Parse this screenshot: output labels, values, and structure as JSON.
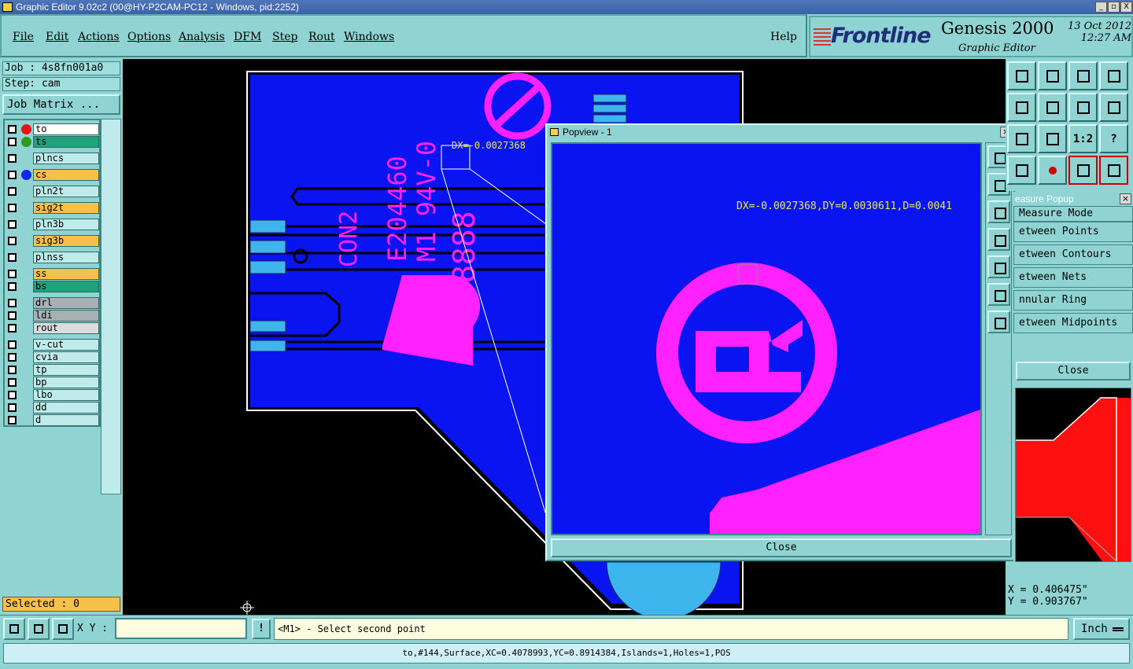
{
  "window": {
    "title": "Graphic Editor 9.02c2 (00@HY-P2CAM-PC12 - Windows, pid:2252)",
    "controls": [
      "_",
      "▫",
      "X"
    ]
  },
  "menu": {
    "items": [
      "File",
      "Edit",
      "Actions",
      "Options",
      "Analysis",
      "DFM",
      "Step",
      "Rout",
      "Windows"
    ],
    "help": "Help"
  },
  "brand": {
    "logo": "Frontline",
    "product": "Genesis 2000",
    "subtitle": "Graphic Editor",
    "date": "13 Oct 2012",
    "time": "12:27 AM"
  },
  "job": {
    "job_label": "Job : 4s8fn001a0",
    "step_label": "Step: cam",
    "matrix_button": "Job Matrix ..."
  },
  "layers": [
    {
      "name": "to",
      "color": "#ffffff",
      "dot": "#ee1010"
    },
    {
      "name": "ts",
      "color": "#1fa37a",
      "dot": "#2a9d20"
    },
    {
      "name": "plncs",
      "color": "#bfeceb",
      "dot": ""
    },
    {
      "name": "cs",
      "color": "#f6c04a",
      "dot": "#1028ee"
    },
    {
      "name": "pln2t",
      "color": "#bfeceb",
      "dot": ""
    },
    {
      "name": "sig2t",
      "color": "#f6c04a",
      "dot": ""
    },
    {
      "name": "pln3b",
      "color": "#bfeceb",
      "dot": ""
    },
    {
      "name": "sig3b",
      "color": "#f6c04a",
      "dot": ""
    },
    {
      "name": "plnss",
      "color": "#bfeceb",
      "dot": ""
    },
    {
      "name": "ss",
      "color": "#f6c04a",
      "dot": ""
    },
    {
      "name": "bs",
      "color": "#1fa37a",
      "dot": ""
    },
    {
      "name": "drl",
      "color": "#a8b0b4",
      "dot": ""
    },
    {
      "name": "ldi",
      "color": "#a8b0b4",
      "dot": ""
    },
    {
      "name": "rout",
      "color": "#dcdcdc",
      "dot": ""
    },
    {
      "name": "v-cut",
      "color": "#bfeceb",
      "dot": ""
    },
    {
      "name": "cvia",
      "color": "#bfeceb",
      "dot": ""
    },
    {
      "name": "tp",
      "color": "#bfeceb",
      "dot": ""
    },
    {
      "name": "bp",
      "color": "#bfeceb",
      "dot": ""
    },
    {
      "name": "lbo",
      "color": "#bfeceb",
      "dot": ""
    },
    {
      "name": "dd",
      "color": "#bfeceb",
      "dot": ""
    },
    {
      "name": "d",
      "color": "#bfeceb",
      "dot": ""
    }
  ],
  "selected": "Selected : 0",
  "board": {
    "silk_texts": [
      "CON2",
      "E204460",
      "M1 94V-0",
      "8888"
    ],
    "measure_label_main": "DX=-0.0027368",
    "copper_color": "#0a14f0",
    "silk_color": "#ff22ff",
    "pad_color": "#3fb5ee"
  },
  "popview": {
    "title": "Popview - 1",
    "measure_text": "DX=-0.0027368,DY=0.0030611,D=0.0041",
    "close": "Close"
  },
  "tools": {
    "ratio_label": "1:2",
    "help_label": "?"
  },
  "measure": {
    "title": "easure Popup",
    "mode_label": "Measure Mode",
    "modes": [
      "etween Points",
      "etween Contours",
      "etween Nets",
      "nnular Ring",
      "etween Midpoints"
    ],
    "close": "Close"
  },
  "coords": {
    "x": "X = 0.406475\"",
    "y": "Y = 0.903767\""
  },
  "command": {
    "xy_label": "X Y :",
    "xy_value": "",
    "bang": "!",
    "prompt": "<M1> - Select second point",
    "units": "Inch"
  },
  "status": "to,#144,Surface,XC=0.4078993,YC=0.8914384,Islands=1,Holes=1,POS"
}
